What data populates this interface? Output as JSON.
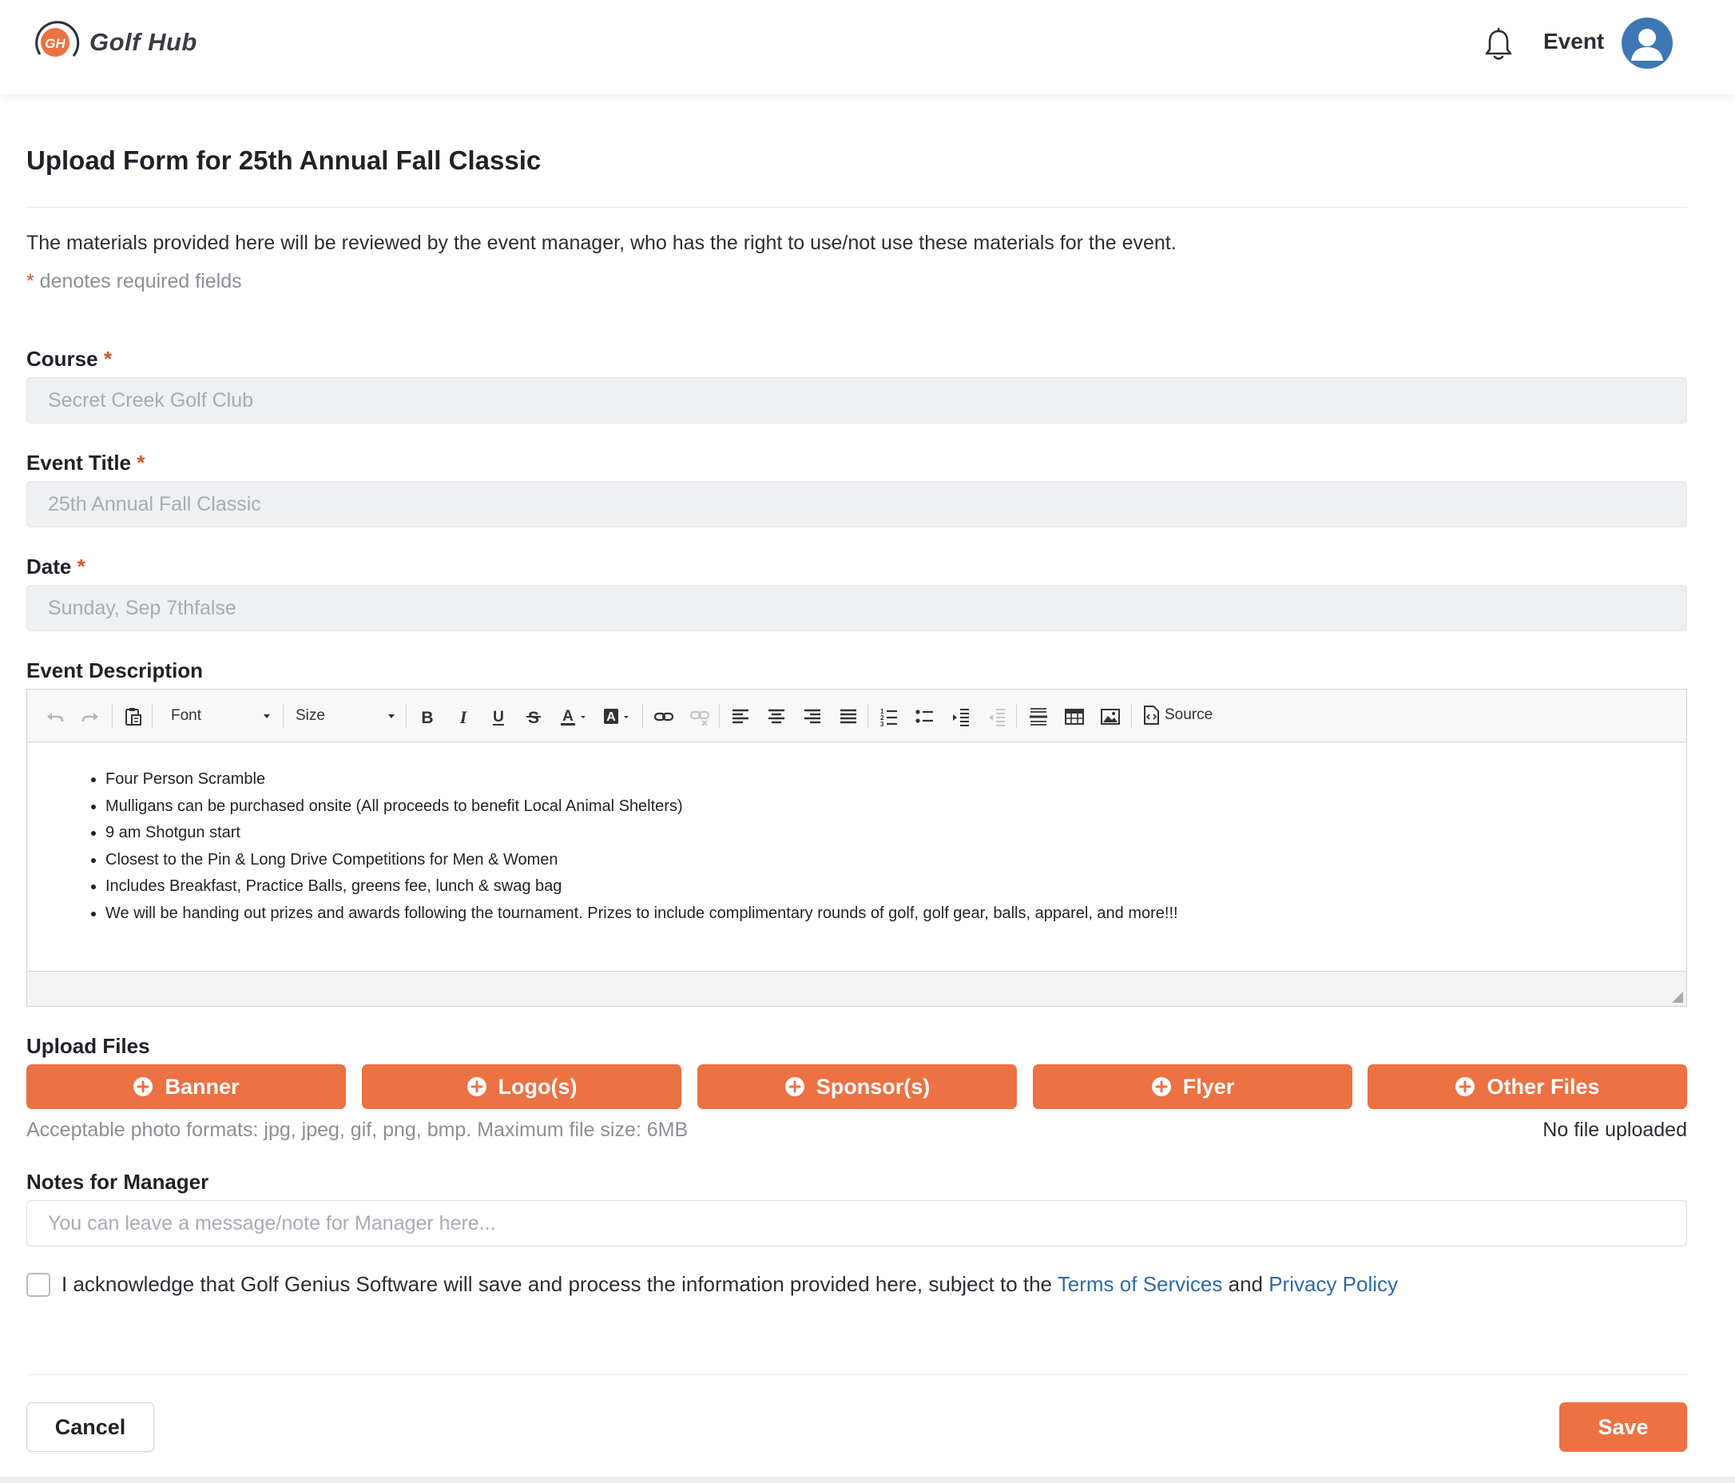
{
  "app": {
    "name": "Golf Hub",
    "logo_initials": "GH"
  },
  "header": {
    "user_label": "Event"
  },
  "page": {
    "title": "Upload Form for 25th Annual Fall Classic",
    "intro": "The materials provided here will be reviewed by the event manager, who has the right to use/not use these materials for the event.",
    "required_star": "*",
    "required_note": " denotes required fields"
  },
  "fields": {
    "course": {
      "label": "Course",
      "value": "Secret Creek Golf Club"
    },
    "event_title": {
      "label": "Event Title",
      "value": "25th Annual Fall Classic"
    },
    "date": {
      "label": "Date",
      "value": "Sunday, Sep 7thfalse"
    }
  },
  "description": {
    "label": "Event Description",
    "toolbar": {
      "font_label": "Font",
      "size_label": "Size",
      "source_label": "Source"
    },
    "items": [
      "Four Person Scramble",
      "Mulligans can be purchased onsite (All proceeds to benefit Local Animal Shelters)",
      "9 am Shotgun start",
      "Closest to the Pin & Long Drive Competitions for Men & Women",
      "Includes Breakfast, Practice Balls, greens fee, lunch & swag bag",
      "We will be handing out prizes and awards following the tournament. Prizes to include complimentary rounds of golf, golf gear, balls, apparel, and more!!!"
    ]
  },
  "uploads": {
    "label": "Upload Files",
    "buttons": [
      "Banner",
      "Logo(s)",
      "Sponsor(s)",
      "Flyer",
      "Other Files"
    ],
    "formats_note": "Acceptable photo formats: jpg, jpeg, gif, png, bmp. Maximum file size: 6MB",
    "status": "No file uploaded"
  },
  "notes": {
    "label": "Notes for Manager",
    "placeholder": "You can leave a message/note for Manager here..."
  },
  "acknowledge": {
    "text": "I acknowledge that Golf Genius Software will save and process the information provided here, subject to the ",
    "terms_link": "Terms of Services",
    "and": " and ",
    "privacy_link": "Privacy Policy"
  },
  "actions": {
    "cancel": "Cancel",
    "save": "Save"
  },
  "colors": {
    "accent": "#ec7143",
    "link": "#2f6aa3",
    "avatar": "#3d78b3"
  }
}
